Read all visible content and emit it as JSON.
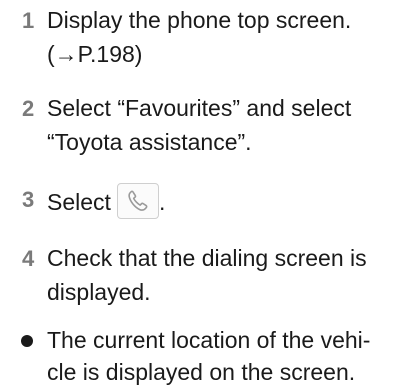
{
  "steps": [
    {
      "number": "1",
      "lines": [
        "Display the phone top screen.",
        "(→P.198)"
      ]
    },
    {
      "number": "2",
      "lines": [
        "Select “Favourites” and select",
        "“Toyota assistance”."
      ]
    },
    {
      "number": "3",
      "text_before_icon": "Select",
      "icon": "phone-call-icon",
      "text_after_icon": "."
    },
    {
      "number": "4",
      "lines": [
        "Check that the dialing screen is",
        "displayed."
      ]
    }
  ],
  "note": {
    "lines": [
      "The current location of the vehi-",
      "cle is displayed on the screen."
    ]
  },
  "colors": {
    "step_number": "#7a7a7a",
    "text": "#1a1a1a",
    "icon_stroke": "#9a9a9a"
  }
}
